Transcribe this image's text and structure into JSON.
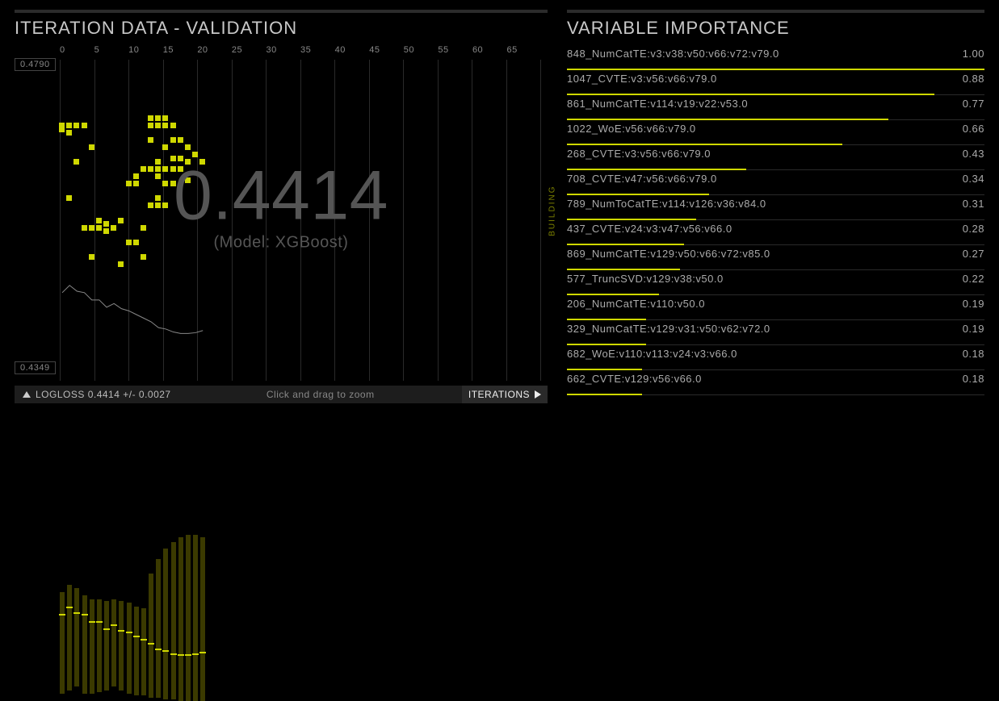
{
  "left_title": "ITERATION DATA - VALIDATION",
  "right_title": "VARIABLE IMPORTANCE",
  "center_value": "0.4414",
  "model_label": "(Model: XGBoost)",
  "building_label": "BUILDING",
  "footer": {
    "metric": "LOGLOSS 0.4414 +/- 0.0027",
    "hint": "Click and drag to zoom",
    "right": "ITERATIONS"
  },
  "chart_data": {
    "type": "scatter",
    "xlabel": "ITERATIONS",
    "ylabel": "LOGLOSS",
    "xlim": [
      0,
      65
    ],
    "ylim": [
      0.4349,
      0.479
    ],
    "x_ticks": [
      0,
      5,
      10,
      15,
      20,
      25,
      30,
      35,
      40,
      45,
      50,
      55,
      60,
      65
    ],
    "y_ticks": [
      "0.4790",
      "0.4349"
    ],
    "best": {
      "value": 0.4414,
      "pm": 0.0027,
      "model": "XGBoost"
    },
    "boxes": [
      {
        "x": 0,
        "lo": 0.436,
        "med": 0.447,
        "hi": 0.45
      },
      {
        "x": 1,
        "lo": 0.4365,
        "med": 0.448,
        "hi": 0.451
      },
      {
        "x": 2,
        "lo": 0.437,
        "med": 0.4472,
        "hi": 0.4505
      },
      {
        "x": 3,
        "lo": 0.436,
        "med": 0.447,
        "hi": 0.4495
      },
      {
        "x": 4,
        "lo": 0.436,
        "med": 0.446,
        "hi": 0.449
      },
      {
        "x": 5,
        "lo": 0.4362,
        "med": 0.446,
        "hi": 0.449
      },
      {
        "x": 6,
        "lo": 0.4365,
        "med": 0.445,
        "hi": 0.4488
      },
      {
        "x": 7,
        "lo": 0.437,
        "med": 0.4455,
        "hi": 0.449
      },
      {
        "x": 8,
        "lo": 0.4365,
        "med": 0.4448,
        "hi": 0.4488
      },
      {
        "x": 9,
        "lo": 0.436,
        "med": 0.4445,
        "hi": 0.4485
      },
      {
        "x": 10,
        "lo": 0.4358,
        "med": 0.444,
        "hi": 0.448
      },
      {
        "x": 11,
        "lo": 0.4358,
        "med": 0.4435,
        "hi": 0.4478
      },
      {
        "x": 12,
        "lo": 0.4355,
        "med": 0.443,
        "hi": 0.4525
      },
      {
        "x": 13,
        "lo": 0.4355,
        "med": 0.4422,
        "hi": 0.4545
      },
      {
        "x": 14,
        "lo": 0.4352,
        "med": 0.442,
        "hi": 0.456
      },
      {
        "x": 15,
        "lo": 0.4352,
        "med": 0.4416,
        "hi": 0.4568
      },
      {
        "x": 16,
        "lo": 0.435,
        "med": 0.4414,
        "hi": 0.4575
      },
      {
        "x": 17,
        "lo": 0.435,
        "med": 0.4414,
        "hi": 0.4578
      },
      {
        "x": 18,
        "lo": 0.435,
        "med": 0.4415,
        "hi": 0.4578
      },
      {
        "x": 19,
        "lo": 0.435,
        "med": 0.4418,
        "hi": 0.4575
      }
    ],
    "points": [
      {
        "x": 0,
        "y": 0.47
      },
      {
        "x": 0,
        "y": 0.4695
      },
      {
        "x": 1,
        "y": 0.47
      },
      {
        "x": 1,
        "y": 0.469
      },
      {
        "x": 1,
        "y": 0.46
      },
      {
        "x": 2,
        "y": 0.47
      },
      {
        "x": 2,
        "y": 0.465
      },
      {
        "x": 3,
        "y": 0.47
      },
      {
        "x": 3,
        "y": 0.456
      },
      {
        "x": 4,
        "y": 0.467
      },
      {
        "x": 4,
        "y": 0.456
      },
      {
        "x": 4,
        "y": 0.452
      },
      {
        "x": 5,
        "y": 0.457
      },
      {
        "x": 5,
        "y": 0.456
      },
      {
        "x": 6,
        "y": 0.4565
      },
      {
        "x": 6,
        "y": 0.4555
      },
      {
        "x": 7,
        "y": 0.456
      },
      {
        "x": 8,
        "y": 0.451
      },
      {
        "x": 8,
        "y": 0.457
      },
      {
        "x": 9,
        "y": 0.462
      },
      {
        "x": 9,
        "y": 0.454
      },
      {
        "x": 10,
        "y": 0.463
      },
      {
        "x": 10,
        "y": 0.462
      },
      {
        "x": 10,
        "y": 0.454
      },
      {
        "x": 11,
        "y": 0.464
      },
      {
        "x": 11,
        "y": 0.456
      },
      {
        "x": 11,
        "y": 0.452
      },
      {
        "x": 12,
        "y": 0.471
      },
      {
        "x": 12,
        "y": 0.47
      },
      {
        "x": 12,
        "y": 0.468
      },
      {
        "x": 12,
        "y": 0.464
      },
      {
        "x": 12,
        "y": 0.459
      },
      {
        "x": 13,
        "y": 0.471
      },
      {
        "x": 13,
        "y": 0.47
      },
      {
        "x": 13,
        "y": 0.465
      },
      {
        "x": 13,
        "y": 0.464
      },
      {
        "x": 13,
        "y": 0.463
      },
      {
        "x": 13,
        "y": 0.46
      },
      {
        "x": 13,
        "y": 0.459
      },
      {
        "x": 14,
        "y": 0.471
      },
      {
        "x": 14,
        "y": 0.47
      },
      {
        "x": 14,
        "y": 0.467
      },
      {
        "x": 14,
        "y": 0.464
      },
      {
        "x": 14,
        "y": 0.462
      },
      {
        "x": 14,
        "y": 0.459
      },
      {
        "x": 15,
        "y": 0.47
      },
      {
        "x": 15,
        "y": 0.468
      },
      {
        "x": 15,
        "y": 0.4655
      },
      {
        "x": 15,
        "y": 0.464
      },
      {
        "x": 15,
        "y": 0.462
      },
      {
        "x": 16,
        "y": 0.468
      },
      {
        "x": 16,
        "y": 0.4655
      },
      {
        "x": 16,
        "y": 0.464
      },
      {
        "x": 17,
        "y": 0.467
      },
      {
        "x": 17,
        "y": 0.465
      },
      {
        "x": 17,
        "y": 0.4625
      },
      {
        "x": 18,
        "y": 0.466
      },
      {
        "x": 19,
        "y": 0.465
      }
    ]
  },
  "importance": [
    {
      "name": "848_NumCatTE:v3:v38:v50:v66:v72:v79.0",
      "value": 1.0
    },
    {
      "name": "1047_CVTE:v3:v56:v66:v79.0",
      "value": 0.88
    },
    {
      "name": "861_NumCatTE:v114:v19:v22:v53.0",
      "value": 0.77
    },
    {
      "name": "1022_WoE:v56:v66:v79.0",
      "value": 0.66
    },
    {
      "name": "268_CVTE:v3:v56:v66:v79.0",
      "value": 0.43
    },
    {
      "name": "708_CVTE:v47:v56:v66:v79.0",
      "value": 0.34
    },
    {
      "name": "789_NumToCatTE:v114:v126:v36:v84.0",
      "value": 0.31
    },
    {
      "name": "437_CVTE:v24:v3:v47:v56:v66.0",
      "value": 0.28
    },
    {
      "name": "869_NumCatTE:v129:v50:v66:v72:v85.0",
      "value": 0.27
    },
    {
      "name": "577_TruncSVD:v129:v38:v50.0",
      "value": 0.22
    },
    {
      "name": "206_NumCatTE:v110:v50.0",
      "value": 0.19
    },
    {
      "name": "329_NumCatTE:v129:v31:v50:v62:v72.0",
      "value": 0.19
    },
    {
      "name": "682_WoE:v110:v113:v24:v3:v66.0",
      "value": 0.18
    },
    {
      "name": "662_CVTE:v129:v56:v66.0",
      "value": 0.18
    }
  ]
}
